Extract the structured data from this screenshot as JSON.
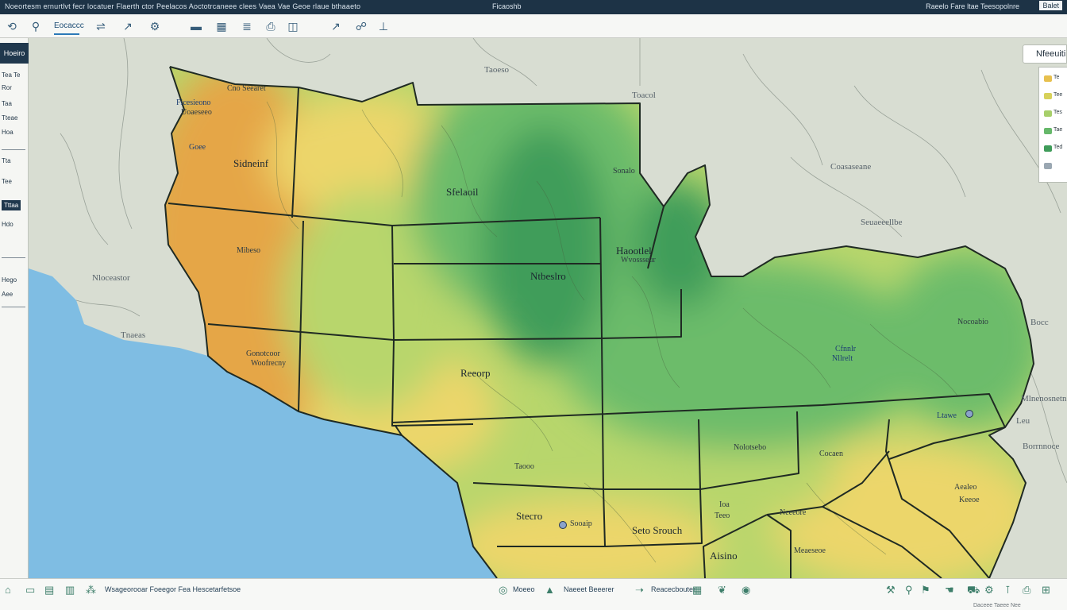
{
  "app": {
    "topbar_left": "Noeortesm ernurtlvt fecr locatuer Flaerth ctor Peelacos Aoctotrcaneee clees Vaea Vae Geoe rlaue bthaaeto",
    "topbar_center": "Ficaoshb",
    "topbar_right": "Raeelo Fare ltae Teesopolnre",
    "topbar_corner": "Balet"
  },
  "toolbar": {
    "home_label": "Eocaccc",
    "icons": [
      "back-icon",
      "pin-icon",
      "layers-icon",
      "measure-icon",
      "print-icon",
      "filter-icon",
      "truck-icon",
      "grid-icon",
      "route-icon",
      "share-icon",
      "chart-icon",
      "stamp-icon"
    ]
  },
  "left_panel": {
    "title": "Hoeiro",
    "items": [
      "Tea Te",
      "Ror",
      "Taa",
      "Tteae",
      "Hoa",
      "Tta",
      "Tee",
      "Tttaa",
      "Hdo",
      "Hego",
      "Aee"
    ]
  },
  "legend": {
    "title": "Nfeeuiti",
    "colors": [
      "#e7c04e",
      "#d7d15a",
      "#a7cf6a",
      "#66b86a",
      "#3f9c5a"
    ],
    "labels": [
      "Te",
      "Tee",
      "Tes",
      "Tae",
      "Ted"
    ]
  },
  "map": {
    "colors": {
      "ocean": "#7fbde3",
      "land_outside": "#d8ddd2",
      "dry": "#e5a647",
      "semi_dry": "#ecd66a",
      "moderate": "#b8d66c",
      "wet": "#6cbc6a",
      "very_wet": "#3f9d5a",
      "border": "#1f2a23"
    },
    "labels": {
      "top_outside": "Taoeso",
      "top_right_outside": "Toacol",
      "northwest_1": "Ficesieono",
      "northwest_2": "Cno Seearet",
      "northwest_3": "Uoaeseeo",
      "northwest_4": "Goee",
      "northwest_5": "Sidneinf",
      "west_center": "Mibeso",
      "coast_outside": "Nloceastor",
      "coast_outside_2": "Tnaeas",
      "southwest_1": "Gonotcoor",
      "southwest_2": "Woofrecny",
      "north_center": "Sfelaoil",
      "north_right": "Sonalo",
      "center_north": "Ntbeslro",
      "center": "Reeorp",
      "east_north_1": "Haootlel",
      "east_north_2": "Wvossseur",
      "east_outside_1": "Coasaseane",
      "east_outside_2": "Seuaeeellbe",
      "east_1": "Nocoabio",
      "east_2": "Cfnnlr",
      "east_3": "Nllrelt",
      "east_edge_1": "Bocc",
      "east_edge_2": "Mlnenosnetn",
      "east_edge_3": "Leu",
      "east_edge_4": "Borrnnoce",
      "southeast_1": "Ltawe",
      "southeast_2": "Nolotsebo",
      "southeast_3": "Cocaen",
      "southeast_4": "Aealeo",
      "southeast_5": "Keeoe",
      "south_1": "Taooo",
      "south_2": "Stecro",
      "south_3": "Sooaip",
      "south_4": "Seto Srouch",
      "south_5": "Ioa",
      "south_6": "Teeo",
      "south_7": "Aisino",
      "south_8": "Meaeseoe",
      "south_9": "Neeeore"
    }
  },
  "bottom_bar": {
    "left_text": "Wsageorooar Foeegor Fea Hescetarfetsoe",
    "center_text_1": "Moeeo",
    "center_text_2": "Naeeet Beeerer",
    "center_text_3": "Reacecbouter",
    "foot_right": "Daceee Taeee Nee"
  }
}
